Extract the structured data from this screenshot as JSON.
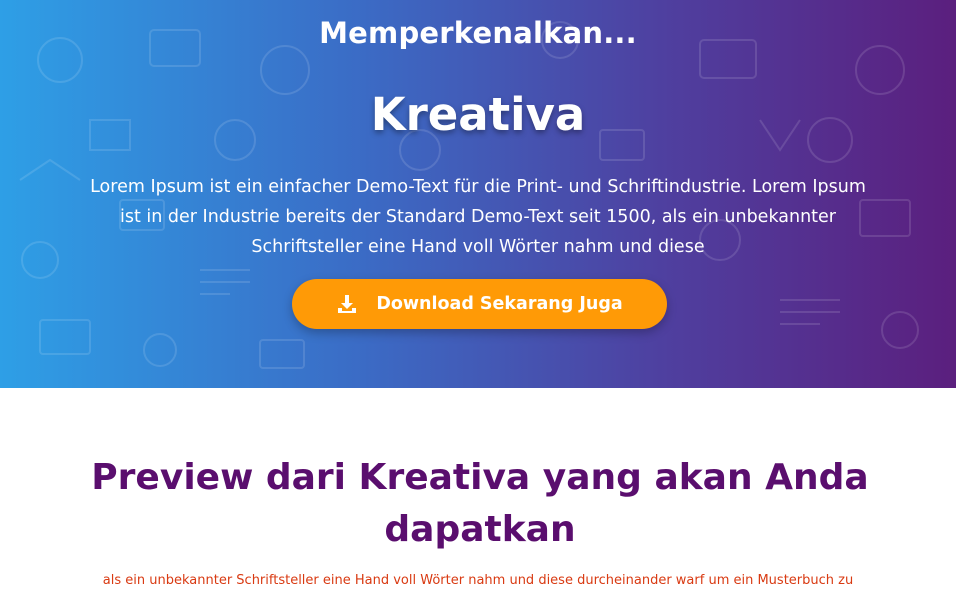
{
  "hero": {
    "intro": "Memperkenalkan...",
    "brand": "Kreativa",
    "description": "Lorem Ipsum ist ein einfacher Demo-Text für die Print- und Schriftindustrie. Lorem Ipsum ist in der Industrie bereits der Standard Demo-Text seit 1500, als ein unbekannter Schriftsteller eine Hand voll Wörter nahm und diese",
    "download_button": {
      "label": "Download Sekarang Juga",
      "icon": "download-icon",
      "color": "#ff9a06"
    },
    "gradient_colors": [
      "#2e9fe6",
      "#5b1f7e"
    ]
  },
  "preview": {
    "title": "Preview dari Kreativa yang akan Anda dapatkan",
    "subtitle": "als ein unbekannter Schriftsteller eine Hand voll Wörter nahm und diese durcheinander warf um ein Musterbuch zu",
    "title_color": "#5a0e6e",
    "subtitle_color": "#d93a12"
  }
}
